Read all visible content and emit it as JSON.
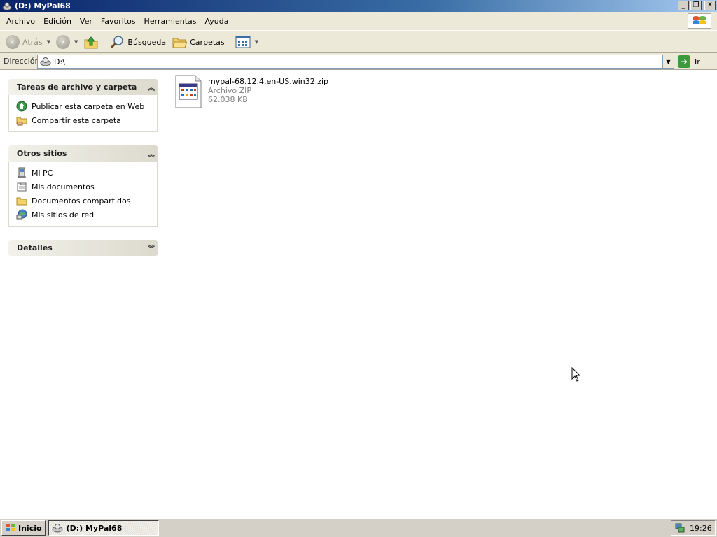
{
  "window": {
    "title": "(D:) MyPal68",
    "controls": {
      "minimize": "_",
      "restore": "❐",
      "close": "✕"
    }
  },
  "menu": {
    "items": [
      "Archivo",
      "Edición",
      "Ver",
      "Favoritos",
      "Herramientas",
      "Ayuda"
    ]
  },
  "toolbar": {
    "back_label": "Atrás",
    "search_label": "Búsqueda",
    "folders_label": "Carpetas"
  },
  "address": {
    "label": "Dirección",
    "value": "D:\\",
    "go_label": "Ir"
  },
  "panes": {
    "tasks": {
      "title": "Tareas de archivo y carpeta",
      "items": [
        "Publicar esta carpeta en Web",
        "Compartir esta carpeta"
      ]
    },
    "other": {
      "title": "Otros sitios",
      "items": [
        "Mi PC",
        "Mis documentos",
        "Documentos compartidos",
        "Mis sitios de red"
      ]
    },
    "details": {
      "title": "Detalles"
    }
  },
  "files": [
    {
      "name": "mypal-68.12.4.en-US.win32.zip",
      "type": "Archivo ZIP",
      "size": "62.038 KB"
    }
  ],
  "taskbar": {
    "start_label": "Inicio",
    "task_label": "(D:) MyPal68",
    "clock": "19:26"
  },
  "colors": {
    "titlebar_start": "#0a246a",
    "titlebar_end": "#a6caf0",
    "chrome": "#ece9d8",
    "pane_header": "#dcdacd"
  }
}
